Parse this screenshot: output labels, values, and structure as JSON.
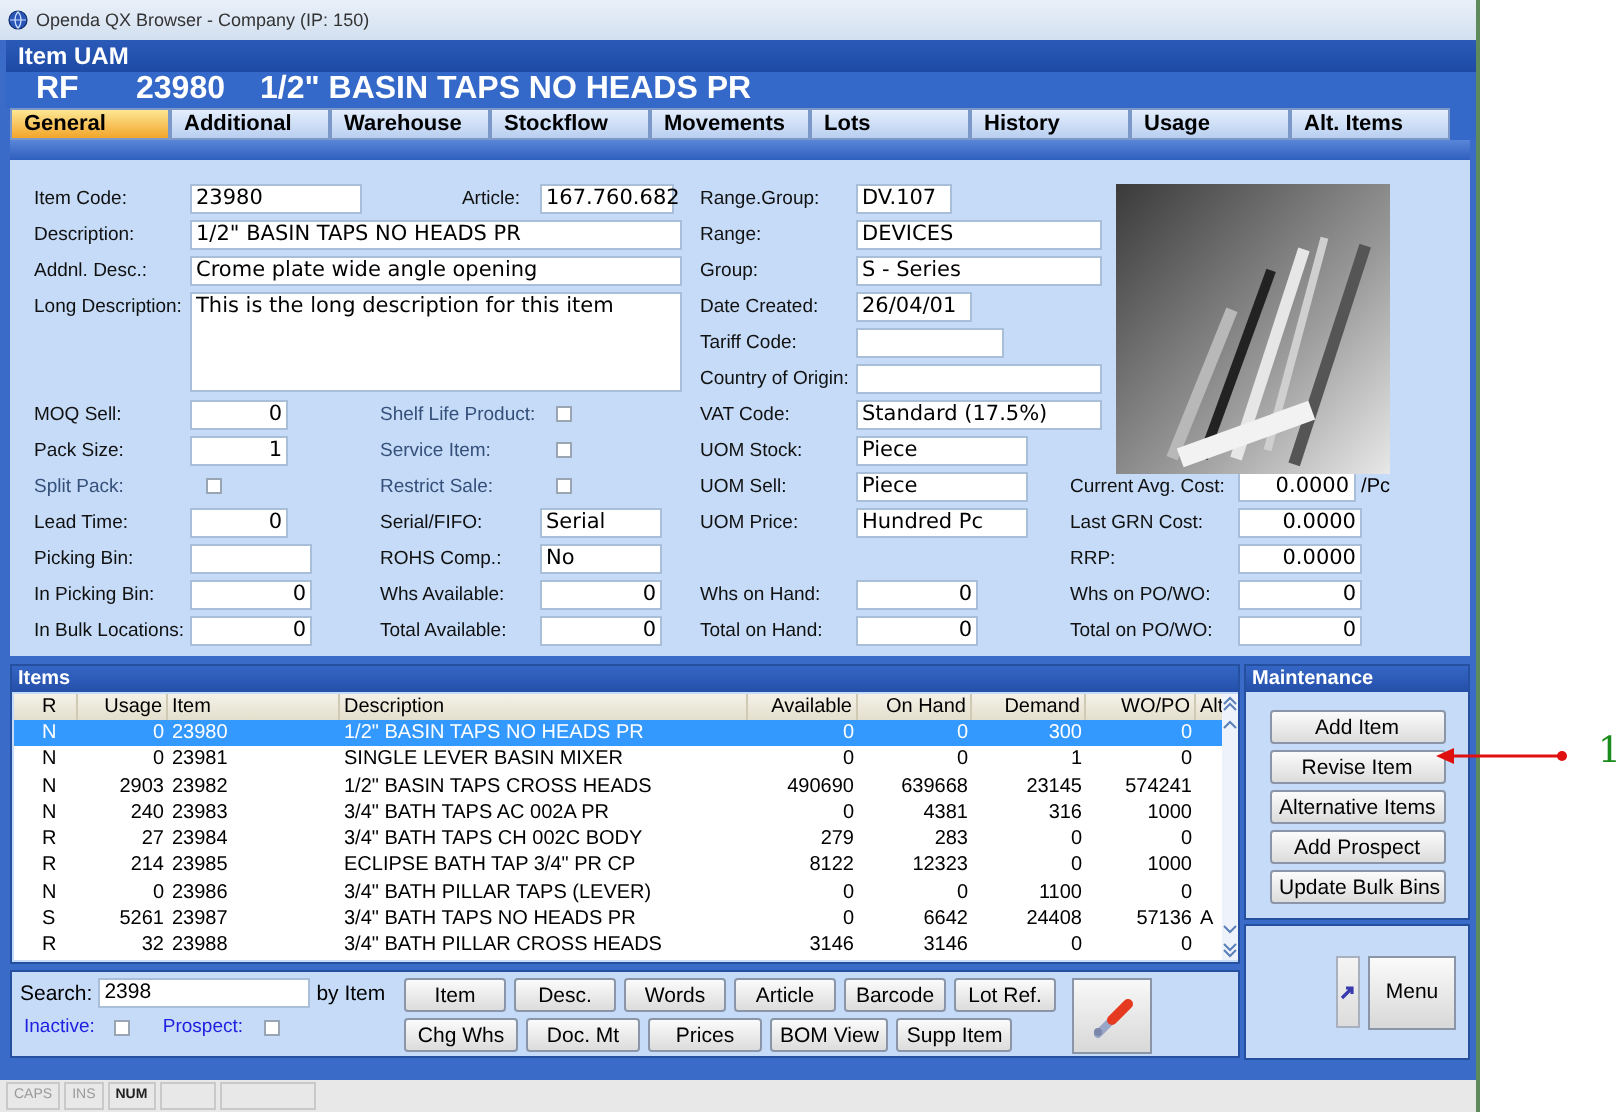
{
  "window": {
    "title": "Openda QX Browser - Company (IP: 150)"
  },
  "screen_title": "Item UAM",
  "item_header": {
    "type": "RF",
    "code": "23980",
    "description": "1/2\" BASIN TAPS NO HEADS PR"
  },
  "tabs": [
    {
      "label": "General",
      "selected": true
    },
    {
      "label": "Additional",
      "selected": false
    },
    {
      "label": "Warehouse",
      "selected": false
    },
    {
      "label": "Stockflow",
      "selected": false
    },
    {
      "label": "Movements",
      "selected": false
    },
    {
      "label": "Lots",
      "selected": false
    },
    {
      "label": "History",
      "selected": false
    },
    {
      "label": "Usage",
      "selected": false
    },
    {
      "label": "Alt. Items",
      "selected": false
    }
  ],
  "fields": [
    {
      "label": "Item Code:",
      "value": "23980",
      "kind": "text"
    },
    {
      "label": "Article:",
      "value": "167.760.682",
      "kind": "text"
    },
    {
      "label": "Range.Group:",
      "value": "DV.107",
      "kind": "text"
    },
    {
      "label": "Description:",
      "value": "1/2\" BASIN TAPS NO HEADS PR",
      "kind": "text"
    },
    {
      "label": "Range:",
      "value": "DEVICES",
      "kind": "text"
    },
    {
      "label": "Addnl. Desc.:",
      "value": "Crome plate wide angle opening",
      "kind": "text"
    },
    {
      "label": "Group:",
      "value": "S - Series",
      "kind": "text"
    },
    {
      "label": "Long Description:",
      "value": "This is the long description for this item",
      "kind": "memo"
    },
    {
      "label": "Date Created:",
      "value": "26/04/01",
      "kind": "text"
    },
    {
      "label": "Tariff Code:",
      "kind": "text"
    },
    {
      "label": "Country of Origin:",
      "kind": "text"
    },
    {
      "label": "MOQ Sell:",
      "value": "0",
      "kind": "number"
    },
    {
      "label": "Shelf Life Product:",
      "kind": "check",
      "checked": false
    },
    {
      "label": "VAT Code:",
      "value": "Standard (17.5%)",
      "kind": "text"
    },
    {
      "label": "Pack Size:",
      "value": "1",
      "kind": "number"
    },
    {
      "label": "Service Item:",
      "kind": "check",
      "checked": false
    },
    {
      "label": "UOM Stock:",
      "value": "Piece",
      "kind": "text"
    },
    {
      "label": "Split Pack:",
      "kind": "check",
      "checked": false
    },
    {
      "label": "Restrict Sale:",
      "kind": "check",
      "checked": false
    },
    {
      "label": "UOM Sell:",
      "value": "Piece",
      "kind": "text"
    },
    {
      "label": "Current Avg. Cost:",
      "value": "0.0000",
      "kind": "number",
      "unit": "/Pc"
    },
    {
      "label": "Lead Time:",
      "value": "0",
      "kind": "number"
    },
    {
      "label": "Serial/FIFO:",
      "value": "Serial",
      "kind": "text"
    },
    {
      "label": "UOM Price:",
      "value": "Hundred Pc",
      "kind": "text"
    },
    {
      "label": "Last GRN Cost:",
      "value": "0.0000",
      "kind": "number"
    },
    {
      "label": "Picking Bin:",
      "kind": "text"
    },
    {
      "label": "ROHS Comp.:",
      "value": "No",
      "kind": "text"
    },
    {
      "label": "RRP:",
      "value": "0.0000",
      "kind": "number"
    },
    {
      "label": "In Picking Bin:",
      "value": "0",
      "kind": "number"
    },
    {
      "label": "Whs Available:",
      "value": "0",
      "kind": "number"
    },
    {
      "label": "Whs on Hand:",
      "value": "0",
      "kind": "number"
    },
    {
      "label": "Whs on PO/WO:",
      "value": "0",
      "kind": "number"
    },
    {
      "label": "In Bulk Locations:",
      "value": "0",
      "kind": "number"
    },
    {
      "label": "Total Available:",
      "value": "0",
      "kind": "number"
    },
    {
      "label": "Total on Hand:",
      "value": "0",
      "kind": "number"
    },
    {
      "label": "Total on PO/WO:",
      "value": "0",
      "kind": "number"
    }
  ],
  "items": {
    "title": "Items",
    "columns": [
      "R",
      "Usage",
      "Item",
      "Description",
      "Available",
      "On Hand",
      "Demand",
      "WO/PO",
      "Alt"
    ],
    "rows": [
      {
        "selected": true,
        "r": "N",
        "usage": "0",
        "item": "23980",
        "description": "1/2\" BASIN TAPS NO HEADS PR",
        "available": "0",
        "on_hand": "0",
        "demand": "300",
        "wo_po": "0"
      },
      {
        "selected": false,
        "r": "N",
        "usage": "0",
        "item": "23981",
        "description": "SINGLE LEVER BASIN MIXER",
        "available": "0",
        "on_hand": "0",
        "demand": "1",
        "wo_po": "0"
      },
      {
        "selected": false,
        "r": "N",
        "usage": "2903",
        "item": "23982",
        "description": "1/2\" BASIN TAPS CROSS HEADS",
        "available": "490690",
        "on_hand": "639668",
        "demand": "23145",
        "wo_po": "574241"
      },
      {
        "selected": false,
        "r": "N",
        "usage": "240",
        "item": "23983",
        "description": "3/4\" BATH TAPS AC 002A PR",
        "available": "0",
        "on_hand": "4381",
        "demand": "316",
        "wo_po": "1000"
      },
      {
        "selected": false,
        "r": "R",
        "usage": "27",
        "item": "23984",
        "description": "3/4\" BATH TAPS CH 002C BODY",
        "available": "279",
        "on_hand": "283",
        "demand": "0",
        "wo_po": "0"
      },
      {
        "selected": false,
        "r": "R",
        "usage": "214",
        "item": "23985",
        "description": "ECLIPSE BATH TAP 3/4\" PR CP",
        "available": "8122",
        "on_hand": "12323",
        "demand": "0",
        "wo_po": "1000"
      },
      {
        "selected": false,
        "r": "N",
        "usage": "0",
        "item": "23986",
        "description": "3/4\" BATH PILLAR TAPS (LEVER)",
        "available": "0",
        "on_hand": "0",
        "demand": "1100",
        "wo_po": "0"
      },
      {
        "selected": false,
        "r": "S",
        "usage": "5261",
        "item": "23987",
        "description": "3/4\" BATH TAPS NO HEADS PR",
        "available": "0",
        "on_hand": "6642",
        "demand": "24408",
        "wo_po": "57136",
        "alt": "A"
      },
      {
        "selected": false,
        "r": "R",
        "usage": "32",
        "item": "23988",
        "description": "3/4\" BATH PILLAR CROSS HEADS",
        "available": "3146",
        "on_hand": "3146",
        "demand": "0",
        "wo_po": "0"
      }
    ]
  },
  "maintenance": {
    "title": "Maintenance",
    "buttons": [
      "Add Item",
      "Revise Item",
      "Alternative Items",
      "Add Prospect",
      "Update Bulk Bins"
    ]
  },
  "search": {
    "label": "Search:",
    "value": "2398",
    "mode": "by Item",
    "filters": [
      {
        "label": "Inactive:",
        "checked": false
      },
      {
        "label": "Prospect:",
        "checked": false
      }
    ],
    "buttons_row_1": [
      "Item",
      "Desc.",
      "Words",
      "Article",
      "Barcode",
      "Lot Ref."
    ],
    "buttons_row_2": [
      "Chg Whs",
      "Doc. Mt",
      "Prices",
      "BOM View",
      "Supp Item"
    ]
  },
  "menu_button": "Menu",
  "status_bar": [
    {
      "label": "CAPS",
      "on": false
    },
    {
      "label": "INS",
      "on": false
    },
    {
      "label": "NUM",
      "on": true
    }
  ],
  "annotation": {
    "label": "1"
  }
}
